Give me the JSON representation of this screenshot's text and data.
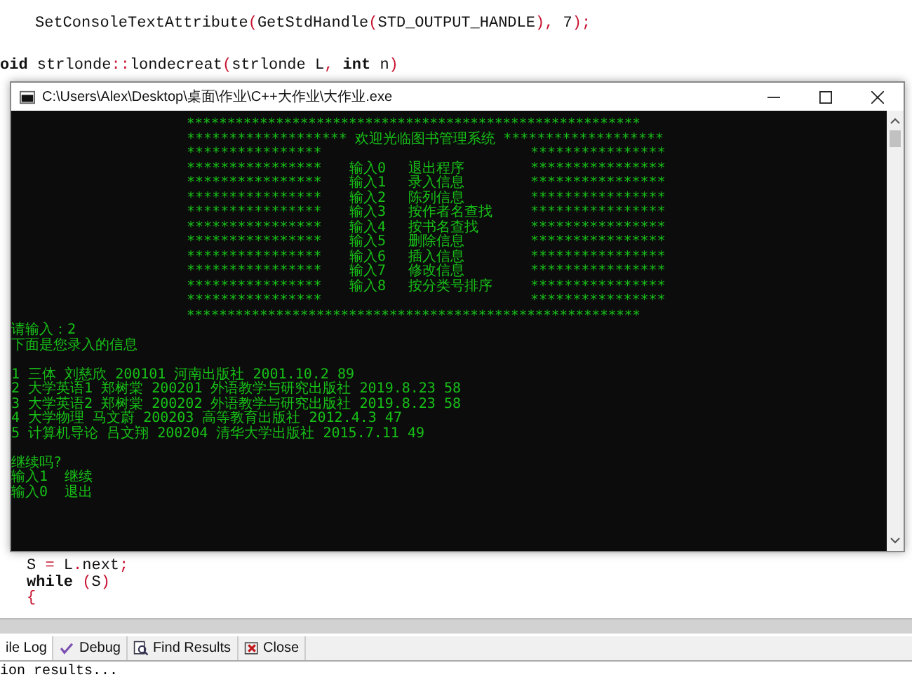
{
  "editor_top": [
    {
      "indent": true,
      "tokens": [
        {
          "text": "SetConsoleTextAttribute",
          "kind": "plain"
        },
        {
          "text": "(",
          "kind": "punct"
        },
        {
          "text": "GetStdHandle",
          "kind": "plain"
        },
        {
          "text": "(",
          "kind": "punct"
        },
        {
          "text": "STD_OUTPUT_HANDLE",
          "kind": "plain"
        },
        {
          "text": "),",
          "kind": "punct"
        },
        {
          "text": " 7",
          "kind": "plain"
        },
        {
          "text": ");",
          "kind": "punct"
        }
      ]
    },
    {
      "indent": false,
      "tokens": [
        {
          "text": "oid",
          "kind": "keyword"
        },
        {
          "text": " strlonde",
          "kind": "plain"
        },
        {
          "text": "::",
          "kind": "punct"
        },
        {
          "text": "londecreat",
          "kind": "plain"
        },
        {
          "text": "(",
          "kind": "punct"
        },
        {
          "text": "strlonde L",
          "kind": "plain"
        },
        {
          "text": ",",
          "kind": "punct"
        },
        {
          "text": " int",
          "kind": "keyword"
        },
        {
          "text": " n",
          "kind": "plain"
        },
        {
          "text": ")",
          "kind": "punct"
        }
      ]
    }
  ],
  "console": {
    "title": "C:\\Users\\Alex\\Desktop\\桌面\\作业\\C++大作业\\大作业.exe",
    "banner": [
      {
        "kind": "full",
        "text": "********************************************************"
      },
      {
        "kind": "title",
        "left": "*******************",
        "title": "欢迎光临图书管理系统",
        "right": "*******************"
      },
      {
        "kind": "side",
        "left": "****************",
        "right": "****************"
      },
      {
        "kind": "menu",
        "left": "****************",
        "key": "输入0",
        "label": "退出程序",
        "right": "****************"
      },
      {
        "kind": "menu",
        "left": "****************",
        "key": "输入1",
        "label": "录入信息",
        "right": "****************"
      },
      {
        "kind": "menu",
        "left": "****************",
        "key": "输入2",
        "label": "陈列信息",
        "right": "****************"
      },
      {
        "kind": "menu",
        "left": "****************",
        "key": "输入3",
        "label": "按作者名查找",
        "right": "****************"
      },
      {
        "kind": "menu",
        "left": "****************",
        "key": "输入4",
        "label": "按书名查找",
        "right": "****************"
      },
      {
        "kind": "menu",
        "left": "****************",
        "key": "输入5",
        "label": "删除信息",
        "right": "****************"
      },
      {
        "kind": "menu",
        "left": "****************",
        "key": "输入6",
        "label": "插入信息",
        "right": "****************"
      },
      {
        "kind": "menu",
        "left": "****************",
        "key": "输入7",
        "label": "修改信息",
        "right": "****************"
      },
      {
        "kind": "menu",
        "left": "****************",
        "key": "输入8",
        "label": "按分类号排序",
        "right": "****************"
      },
      {
        "kind": "side",
        "left": "****************",
        "right": "****************"
      },
      {
        "kind": "full",
        "text": "********************************************************"
      }
    ],
    "output": [
      {
        "kind": "text",
        "text": "请输入：2"
      },
      {
        "kind": "text",
        "text": "下面是您录入的信息"
      },
      {
        "kind": "blank"
      },
      {
        "kind": "text",
        "text": "1 三体 刘慈欣 200101 河南出版社 2001.10.2 89"
      },
      {
        "kind": "text",
        "text": "2 大学英语1 郑树棠 200201 外语教学与研究出版社 2019.8.23 58"
      },
      {
        "kind": "text",
        "text": "3 大学英语2 郑树棠 200202 外语教学与研究出版社 2019.8.23 58"
      },
      {
        "kind": "text",
        "text": "4 大学物理 马文蔚 200203 高等教育出版社 2012.4.3 47"
      },
      {
        "kind": "text",
        "text": "5 计算机导论 吕文翔 200204 清华大学出版社 2015.7.11 49"
      },
      {
        "kind": "blank"
      },
      {
        "kind": "text",
        "text": "继续吗?"
      },
      {
        "kind": "text",
        "text": "输入1  继续"
      },
      {
        "kind": "text",
        "text": "输入0  退出"
      }
    ]
  },
  "editor_bottom": [
    {
      "tokens": [
        {
          "text": "S ",
          "kind": "plain"
        },
        {
          "text": "=",
          "kind": "punct"
        },
        {
          "text": " L",
          "kind": "plain"
        },
        {
          "text": ".",
          "kind": "punct"
        },
        {
          "text": "next",
          "kind": "plain"
        },
        {
          "text": ";",
          "kind": "punct"
        }
      ]
    },
    {
      "tokens": [
        {
          "text": "while",
          "kind": "keyword"
        },
        {
          "text": " (",
          "kind": "punct"
        },
        {
          "text": "S",
          "kind": "plain"
        },
        {
          "text": ")",
          "kind": "punct"
        }
      ]
    },
    {
      "tokens": [
        {
          "text": "{",
          "kind": "punct"
        }
      ]
    }
  ],
  "bottom_tabs": [
    {
      "kind": "none",
      "label": "ile Log",
      "selected": true
    },
    {
      "kind": "debug",
      "label": "Debug",
      "selected": false
    },
    {
      "kind": "find",
      "label": "Find Results",
      "selected": false
    },
    {
      "kind": "close",
      "label": "Close",
      "selected": false
    }
  ],
  "log_text": "ion results..."
}
